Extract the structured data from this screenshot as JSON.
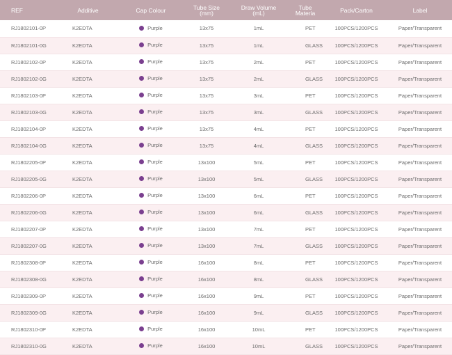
{
  "colors": {
    "header_bg": "#c2a8ae",
    "row_alt_bg": "#fbeff1",
    "cap_purple": "#7a3f8f"
  },
  "table": {
    "headers": [
      [
        "REF"
      ],
      [
        "Additive"
      ],
      [
        "Cap Colour"
      ],
      [
        "Tube Size",
        "(mm)"
      ],
      [
        "Draw Volume",
        "(mL)"
      ],
      [
        "Tube",
        "Materia"
      ],
      [
        "Pack/Carton"
      ],
      [
        "Label"
      ]
    ],
    "rows": [
      {
        "ref": "RJ1802101-0P",
        "additive": "K2EDTA",
        "cap": "Purple",
        "size": "13x75",
        "volume": "1mL",
        "material": "PET",
        "pack": "100PCS/1200PCS",
        "label": "Paper/Transparent"
      },
      {
        "ref": "RJ1802101-0G",
        "additive": "K2EDTA",
        "cap": "Purple",
        "size": "13x75",
        "volume": "1mL",
        "material": "GLASS",
        "pack": "100PCS/1200PCS",
        "label": "Paper/Transparent"
      },
      {
        "ref": "RJ1802102-0P",
        "additive": "K2EDTA",
        "cap": "Purple",
        "size": "13x75",
        "volume": "2mL",
        "material": "PET",
        "pack": "100PCS/1200PCS",
        "label": "Paper/Transparent"
      },
      {
        "ref": "RJ1802102-0G",
        "additive": "K2EDTA",
        "cap": "Purple",
        "size": "13x75",
        "volume": "2mL",
        "material": "GLASS",
        "pack": "100PCS/1200PCS",
        "label": "Paper/Transparent"
      },
      {
        "ref": "RJ1802103-0P",
        "additive": "K2EDTA",
        "cap": "Purple",
        "size": "13x75",
        "volume": "3mL",
        "material": "PET",
        "pack": "100PCS/1200PCS",
        "label": "Paper/Transparent"
      },
      {
        "ref": "RJ1802103-0G",
        "additive": "K2EDTA",
        "cap": "Purple",
        "size": "13x75",
        "volume": "3mL",
        "material": "GLASS",
        "pack": "100PCS/1200PCS",
        "label": "Paper/Transparent"
      },
      {
        "ref": "RJ1802104-0P",
        "additive": "K2EDTA",
        "cap": "Purple",
        "size": "13x75",
        "volume": "4mL",
        "material": "PET",
        "pack": "100PCS/1200PCS",
        "label": "Paper/Transparent"
      },
      {
        "ref": "RJ1802104-0G",
        "additive": "K2EDTA",
        "cap": "Purple",
        "size": "13x75",
        "volume": "4mL",
        "material": "GLASS",
        "pack": "100PCS/1200PCS",
        "label": "Paper/Transparent"
      },
      {
        "ref": "RJ1802205-0P",
        "additive": "K2EDTA",
        "cap": "Purple",
        "size": "13x100",
        "volume": "5mL",
        "material": "PET",
        "pack": "100PCS/1200PCS",
        "label": "Paper/Transparent"
      },
      {
        "ref": "RJ1802205-0G",
        "additive": "K2EDTA",
        "cap": "Purple",
        "size": "13x100",
        "volume": "5mL",
        "material": "GLASS",
        "pack": "100PCS/1200PCS",
        "label": "Paper/Transparent"
      },
      {
        "ref": "RJ1802206-0P",
        "additive": "K2EDTA",
        "cap": "Purple",
        "size": "13x100",
        "volume": "6mL",
        "material": "PET",
        "pack": "100PCS/1200PCS",
        "label": "Paper/Transparent"
      },
      {
        "ref": "RJ1802206-0G",
        "additive": "K2EDTA",
        "cap": "Purple",
        "size": "13x100",
        "volume": "6mL",
        "material": "GLASS",
        "pack": "100PCS/1200PCS",
        "label": "Paper/Transparent"
      },
      {
        "ref": "RJ1802207-0P",
        "additive": "K2EDTA",
        "cap": "Purple",
        "size": "13x100",
        "volume": "7mL",
        "material": "PET",
        "pack": "100PCS/1200PCS",
        "label": "Paper/Transparent"
      },
      {
        "ref": "RJ1802207-0G",
        "additive": "K2EDTA",
        "cap": "Purple",
        "size": "13x100",
        "volume": "7mL",
        "material": "GLASS",
        "pack": "100PCS/1200PCS",
        "label": "Paper/Transparent"
      },
      {
        "ref": "RJ1802308-0P",
        "additive": "K2EDTA",
        "cap": "Purple",
        "size": "16x100",
        "volume": "8mL",
        "material": "PET",
        "pack": "100PCS/1200PCS",
        "label": "Paper/Transparent"
      },
      {
        "ref": "RJ1802308-0G",
        "additive": "K2EDTA",
        "cap": "Purple",
        "size": "16x100",
        "volume": "8mL",
        "material": "GLASS",
        "pack": "100PCS/1200PCS",
        "label": "Paper/Transparent"
      },
      {
        "ref": "RJ1802309-0P",
        "additive": "K2EDTA",
        "cap": "Purple",
        "size": "16x100",
        "volume": "9mL",
        "material": "PET",
        "pack": "100PCS/1200PCS",
        "label": "Paper/Transparent"
      },
      {
        "ref": "RJ1802309-0G",
        "additive": "K2EDTA",
        "cap": "Purple",
        "size": "16x100",
        "volume": "9mL",
        "material": "GLASS",
        "pack": "100PCS/1200PCS",
        "label": "Paper/Transparent"
      },
      {
        "ref": "RJ1802310-0P",
        "additive": "K2EDTA",
        "cap": "Purple",
        "size": "16x100",
        "volume": "10mL",
        "material": "PET",
        "pack": "100PCS/1200PCS",
        "label": "Paper/Transparent"
      },
      {
        "ref": "RJ1802310-0G",
        "additive": "K2EDTA",
        "cap": "Purple",
        "size": "16x100",
        "volume": "10mL",
        "material": "GLASS",
        "pack": "100PCS/1200PCS",
        "label": "Paper/Transparent"
      }
    ]
  }
}
